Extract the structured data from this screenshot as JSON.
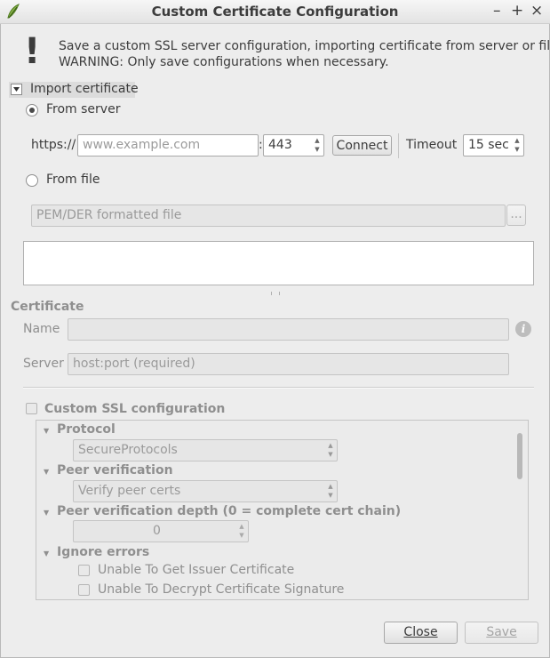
{
  "window": {
    "title": "Custom Certificate Configuration",
    "controls": {
      "minimize": "–",
      "maximize": "+",
      "close": "×"
    }
  },
  "info": {
    "icon": "!",
    "line1": "Save a custom SSL server configuration, importing certificate from server or file.",
    "line2": "WARNING: Only save configurations when necessary."
  },
  "import": {
    "toggle_label": "Import certificate",
    "from_server_label": "From server",
    "url_prefix": "https://",
    "url_placeholder": "www.example.com",
    "colon": ":",
    "port": "443",
    "connect_label": "Connect",
    "timeout_label": "Timeout",
    "timeout_value": "15 sec",
    "from_file_label": "From file",
    "file_placeholder": "PEM/DER formatted file",
    "browse_label": "..."
  },
  "certificate": {
    "heading": "Certificate",
    "name_label": "Name",
    "server_label": "Server",
    "server_placeholder": "host:port (required)"
  },
  "ssl": {
    "checkbox_label": "Custom SSL configuration",
    "protocol_label": "Protocol",
    "protocol_value": "SecureProtocols",
    "peer_verification_label": "Peer verification",
    "peer_verification_value": "Verify peer certs",
    "peer_depth_label": "Peer verification depth (0 = complete cert chain)",
    "peer_depth_value": "0",
    "ignore_errors_label": "Ignore errors",
    "errors": [
      "Unable To Get Issuer Certificate",
      "Unable To Decrypt Certificate Signature"
    ]
  },
  "footer": {
    "close_label": "Close",
    "save_label": "Save"
  }
}
